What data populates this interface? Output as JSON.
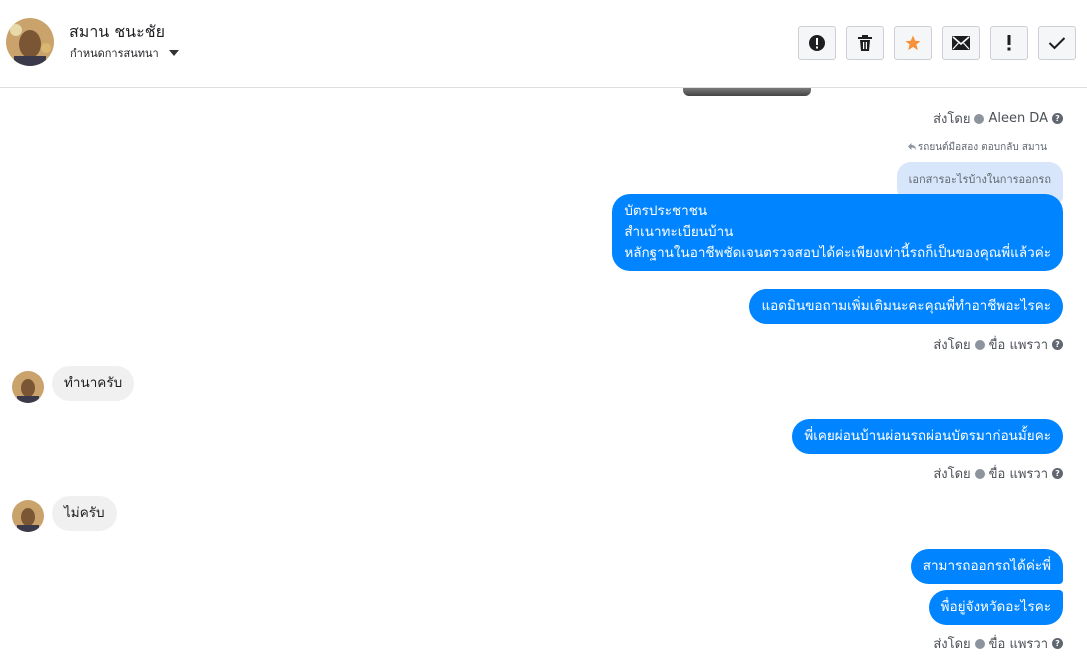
{
  "header": {
    "contact_name": "สมาน ชนะชัย",
    "subtitle": "กำหนดการสนทนา",
    "toolbar": {
      "colors": {
        "star": "#f7923a",
        "icon": "#1c1e21"
      }
    }
  },
  "messages": {
    "sent_by_1": {
      "label": "ส่งโดย",
      "name": "Aleen DA"
    },
    "reply_note": "รถยนต์มือสอง ตอบกลับ สมาน",
    "quoted_text": "เอกสารอะไรบ้างในการออกรถ",
    "out_1": {
      "line1": "บัตรประชาชน",
      "line2": "สำเนาทะเบียนบ้าน",
      "line3": "หลักฐานในอาชีพชัดเจนตรวจสอบได้ค่ะเพียงเท่านี้รถก็เป็นของคุณพี่แล้วค่ะ"
    },
    "out_2": "แอดมินขอถามเพิ่มเติมนะคะคุณพี่ทำอาชีพอะไรคะ",
    "sent_by_2": {
      "label": "ส่งโดย",
      "name": "ขื่อ แพรวา"
    },
    "in_1": "ทำนาครับ",
    "out_3": "พี่เคยผ่อนบ้านผ่อนรถผ่อนบัตรมาก่อนมั้ยคะ",
    "sent_by_3": {
      "label": "ส่งโดย",
      "name": "ขื่อ แพรวา"
    },
    "in_2": "ไม่ครับ",
    "out_4": "สามารถออกรถได้ค่ะพี่",
    "out_5": "พื่อยู่จังหวัดอะไรคะ",
    "sent_by_4": {
      "label": "ส่งโดย",
      "name": "ขื่อ แพรวา"
    }
  },
  "colors": {
    "bubble_out": "#0084ff",
    "bubble_in": "#f1f0f0",
    "quoted": "#d8e6fb"
  }
}
